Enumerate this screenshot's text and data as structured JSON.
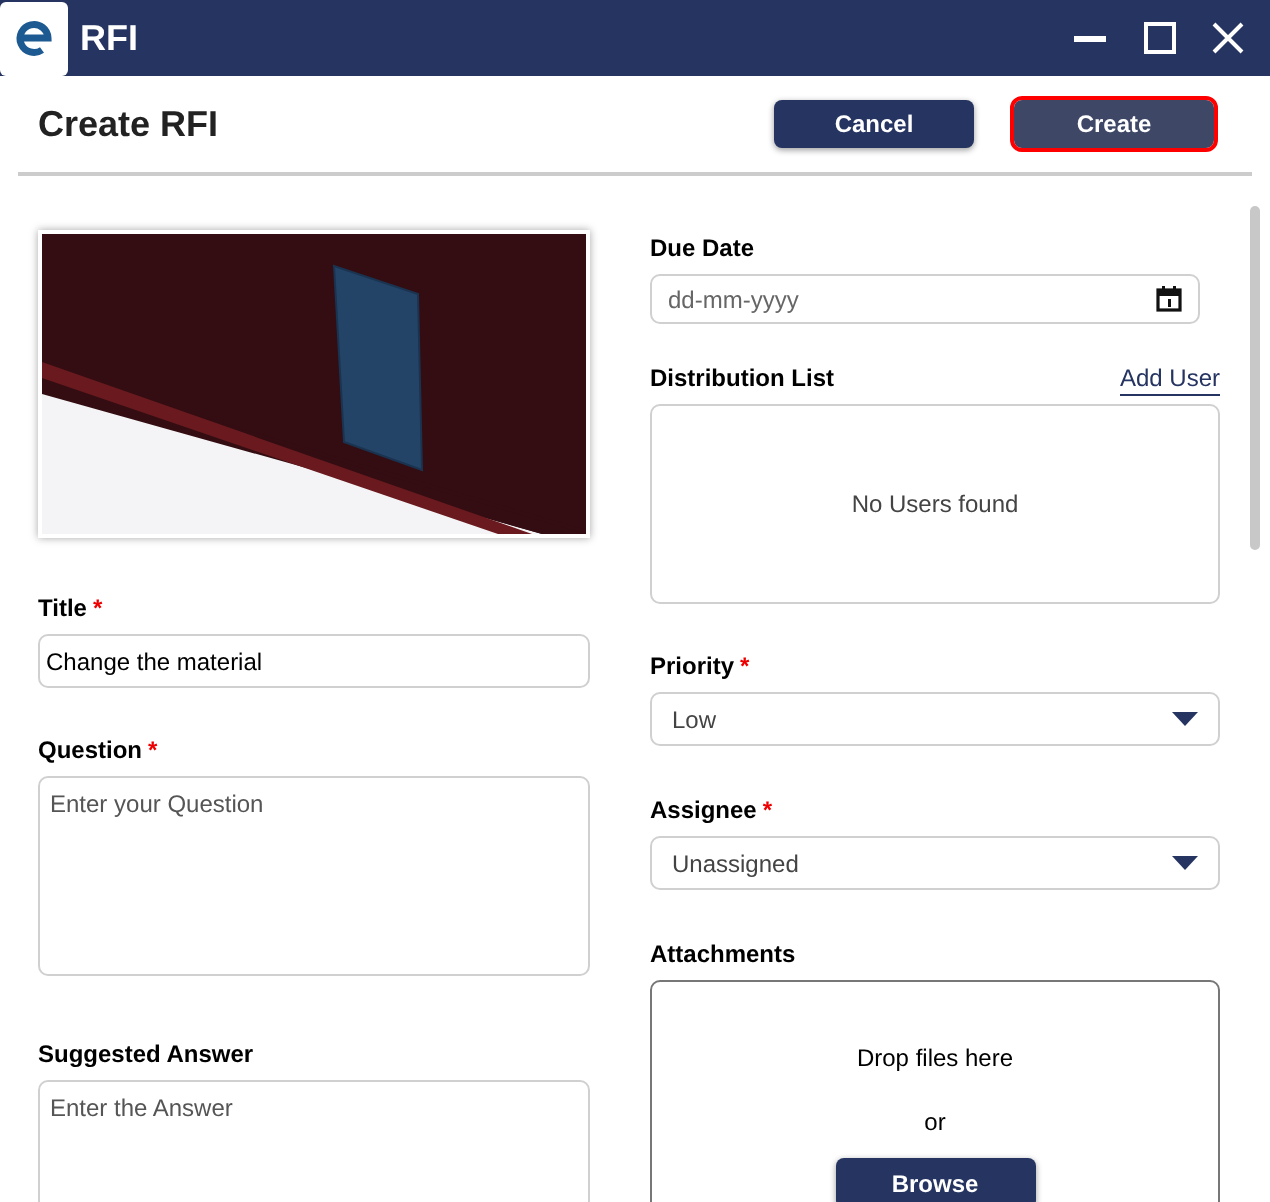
{
  "window": {
    "title": "RFI"
  },
  "header": {
    "title": "Create RFI",
    "buttons": [
      {
        "label": "Cancel",
        "disabled": false,
        "focused": false
      },
      {
        "label": "Create",
        "disabled": true,
        "focused": true
      }
    ]
  },
  "left_fields": [
    {
      "kind": "text",
      "label": "Title",
      "required_mark": "*",
      "value": "Change the material"
    },
    {
      "kind": "textarea",
      "label": "Question",
      "required_mark": "*",
      "placeholder": "Enter your Question"
    },
    {
      "kind": "textarea",
      "label": "Suggested Answer",
      "placeholder": "Enter the Answer"
    }
  ],
  "right_fields": [
    {
      "kind": "date",
      "label": "Due Date",
      "placeholder": "dd-mm-yyyy"
    },
    {
      "kind": "users",
      "label": "Distribution List",
      "link": "Add User",
      "empty": "No Users found"
    },
    {
      "kind": "select",
      "label": "Priority",
      "required_mark": "*",
      "value": "Low"
    },
    {
      "kind": "select",
      "label": "Assignee",
      "required_mark": "*",
      "value": "Unassigned"
    },
    {
      "kind": "dropzone",
      "label": "Attachments",
      "hint": "Drop files here",
      "or": "or",
      "button": "Browse"
    }
  ]
}
